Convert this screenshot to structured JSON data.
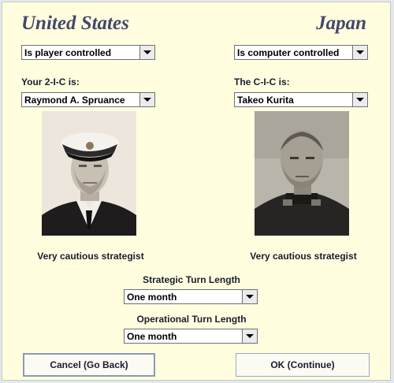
{
  "us": {
    "title": "United States",
    "control": "Is player controlled",
    "commander_label": "Your 2-I-C is:",
    "commander": "Raymond A. Spruance",
    "strategy": "Very cautious strategist"
  },
  "japan": {
    "title": "Japan",
    "control": "Is computer controlled",
    "commander_label": "The C-I-C is:",
    "commander": "Takeo Kurita",
    "strategy": "Very cautious strategist"
  },
  "turns": {
    "strategic_label": "Strategic Turn Length",
    "strategic_value": "One month",
    "operational_label": "Operational Turn Length",
    "operational_value": "One month"
  },
  "buttons": {
    "cancel": "Cancel (Go Back)",
    "ok": "OK (Continue)"
  },
  "colors": {
    "panel_background": "#ffffe0",
    "title_color": "#45476a"
  }
}
